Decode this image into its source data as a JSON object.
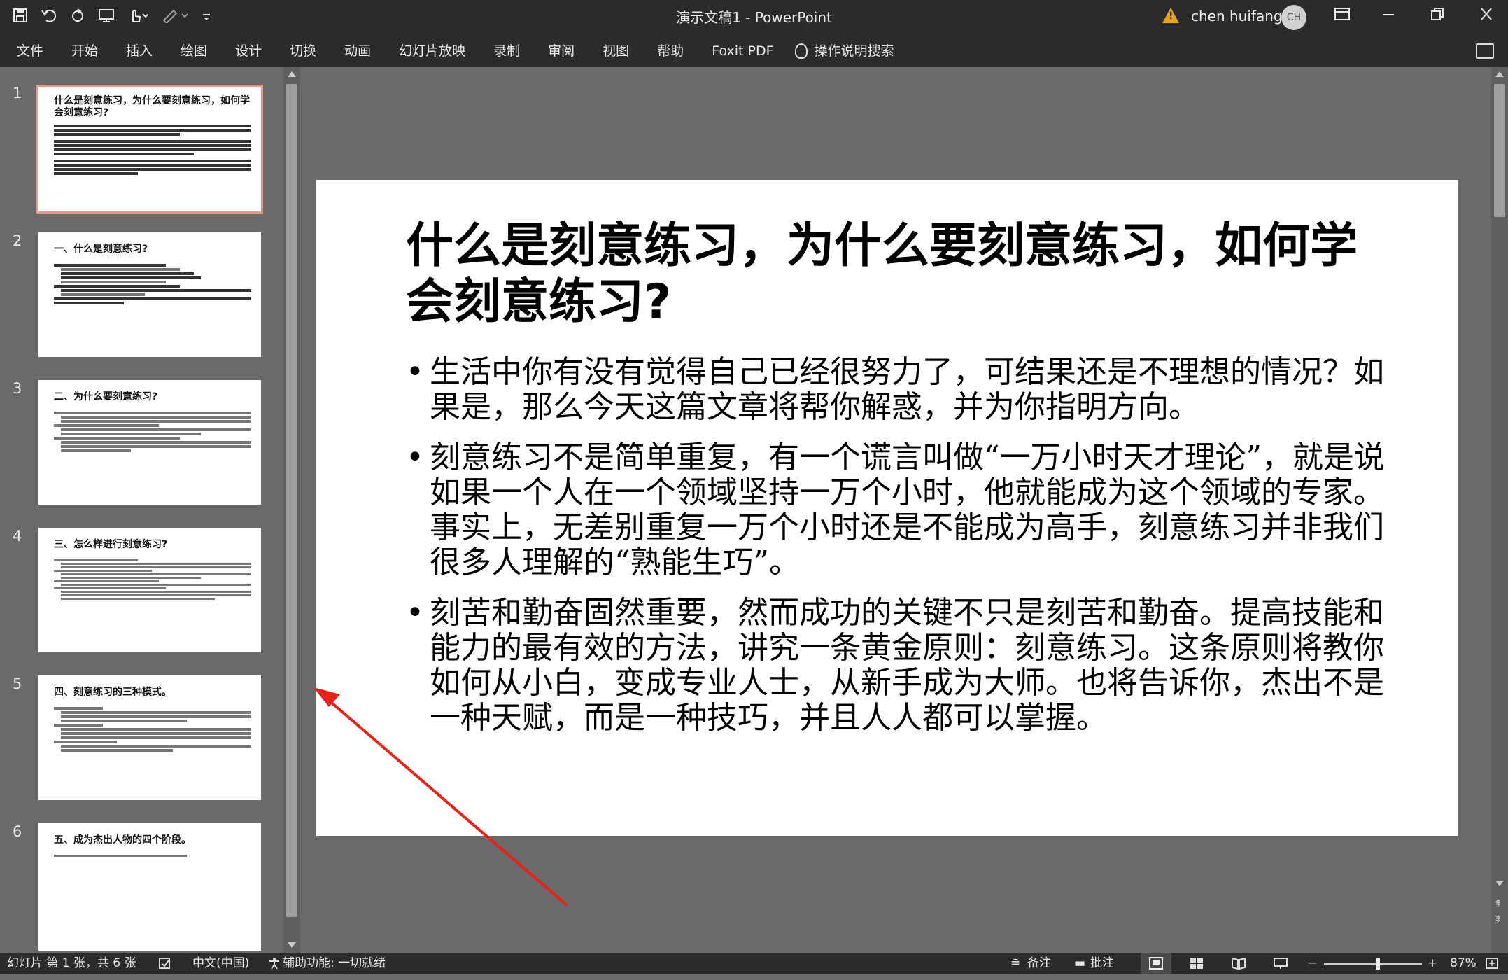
{
  "window": {
    "title": "演示文稿1  -  PowerPoint",
    "user": "chen huifang",
    "avatar_initials": "CH"
  },
  "ribbon": {
    "tabs": [
      "文件",
      "开始",
      "插入",
      "绘图",
      "设计",
      "切换",
      "动画",
      "幻灯片放映",
      "录制",
      "审阅",
      "视图",
      "帮助",
      "Foxit PDF"
    ],
    "search_label": "操作说明搜索"
  },
  "thumbnails": [
    {
      "num": "1",
      "title": "什么是刻意练习，为什么要刻意练习，如何学会刻意练习?"
    },
    {
      "num": "2",
      "title": "一、什么是刻意练习?"
    },
    {
      "num": "3",
      "title": "二、为什么要刻意练习?"
    },
    {
      "num": "4",
      "title": "三、怎么样进行刻意练习?"
    },
    {
      "num": "5",
      "title": "四、刻意练习的三种模式。"
    },
    {
      "num": "6",
      "title": "五、成为杰出人物的四个阶段。"
    }
  ],
  "slide": {
    "title": "什么是刻意练习，为什么要刻意练习，如何学会刻意练习?",
    "bullets": [
      "生活中你有没有觉得自己已经很努力了，可结果还是不理想的情况？如果是，那么今天这篇文章将帮你解惑，并为你指明方向。",
      "刻意练习不是简单重复，有一个谎言叫做“一万小时天才理论”，就是说如果一个人在一个领域坚持一万个小时，他就能成为这个领域的专家。事实上，无差别重复一万个小时还是不能成为高手，刻意练习并非我们很多人理解的“熟能生巧”。",
      "刻苦和勤奋固然重要，然而成功的关键不只是刻苦和勤奋。提高技能和能力的最有效的方法，讲究一条黄金原则：刻意练习。这条原则将教你如何从小白，变成专业人士，从新手成为大师。也将告诉你，杰出不是一种天赋，而是一种技巧，并且人人都可以掌握。"
    ]
  },
  "status": {
    "slide_info": "幻灯片 第 1 张，共 6 张",
    "language": "中文(中国)",
    "accessibility": "辅助功能: 一切就绪",
    "notes": "备注",
    "comments": "批注",
    "zoom": "87%",
    "zoom_fraction": 0.55
  },
  "colors": {
    "chrome": "#2b2b2b",
    "workspace": "#6a6a6a",
    "selected_border": "#e39a87",
    "annotation_arrow": "#e8221b",
    "warning": "#e8a317"
  }
}
